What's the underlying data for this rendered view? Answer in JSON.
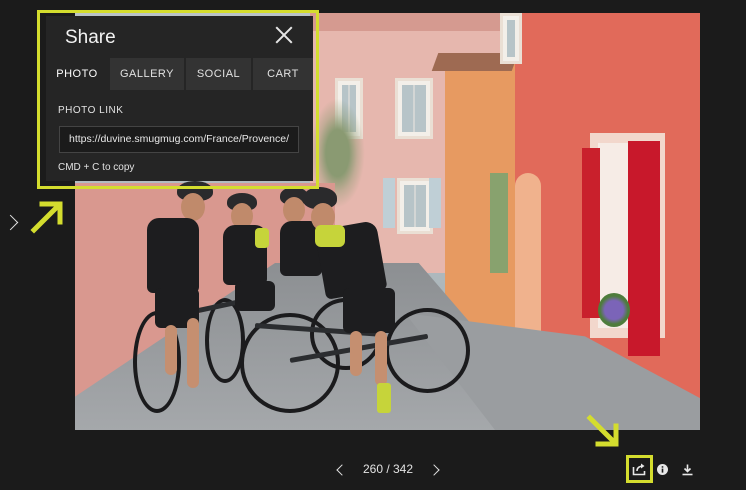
{
  "share": {
    "title": "Share",
    "tabs": [
      {
        "label": "PHOTO",
        "active": true
      },
      {
        "label": "GALLERY",
        "active": false
      },
      {
        "label": "SOCIAL",
        "active": false
      },
      {
        "label": "CART",
        "active": false
      }
    ],
    "photo_link_label": "PHOTO LINK",
    "photo_link_value": "https://duvine.smugmug.com/France/Provence/",
    "copy_hint": "CMD + C to copy"
  },
  "navigation": {
    "counter": "260 / 342",
    "current": 260,
    "total": 342
  },
  "toolbar": {
    "icons": [
      "share-icon",
      "info-icon",
      "download-icon"
    ]
  },
  "colors": {
    "highlight": "#d4dd2e",
    "background": "#1b1b1b",
    "panel": "#252525"
  }
}
